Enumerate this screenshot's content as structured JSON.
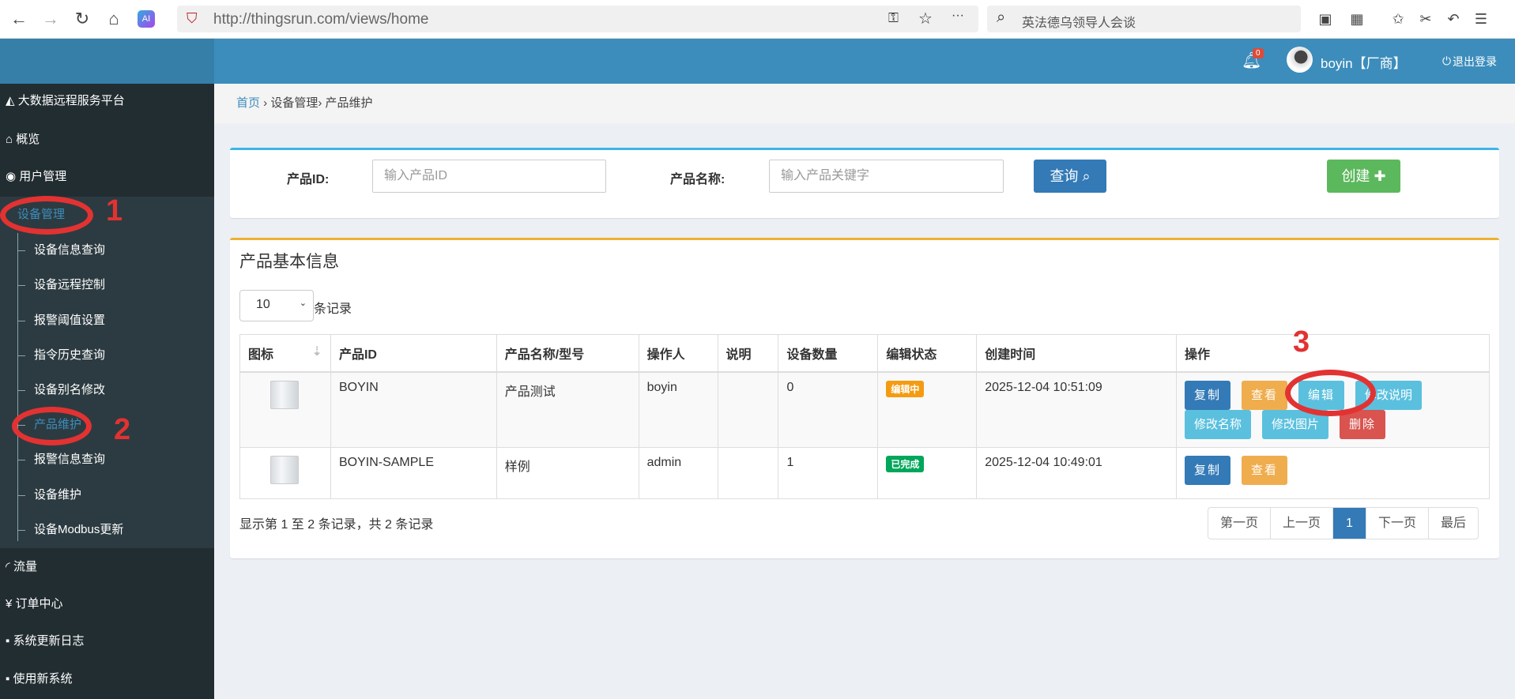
{
  "browser": {
    "url": "http://thingsrun.com/views/home",
    "search": "英法德乌领导人会谈",
    "ai_label": "AI"
  },
  "header": {
    "notif_count": "0",
    "user": "boyin【厂商】",
    "logout": "退出登录"
  },
  "sidebar": {
    "brand": "大数据远程服务平台",
    "items": [
      {
        "label": "概览"
      },
      {
        "label": "用户管理"
      },
      {
        "label": "设备管理"
      }
    ],
    "sub": [
      {
        "label": "设备信息查询"
      },
      {
        "label": "设备远程控制"
      },
      {
        "label": "报警阈值设置"
      },
      {
        "label": "指令历史查询"
      },
      {
        "label": "设备别名修改"
      },
      {
        "label": "产品维护"
      },
      {
        "label": "报警信息查询"
      },
      {
        "label": "设备维护"
      },
      {
        "label": "设备Modbus更新"
      }
    ],
    "bottom": [
      {
        "label": "流量"
      },
      {
        "label": "订单中心"
      },
      {
        "label": "系统更新日志"
      },
      {
        "label": "使用新系统"
      }
    ]
  },
  "breadcrumb": [
    "首页",
    "设备管理",
    "产品维护"
  ],
  "search": {
    "id_label": "产品ID:",
    "id_placeholder": "输入产品ID",
    "name_label": "产品名称:",
    "name_placeholder": "输入产品关键字",
    "query": "查询",
    "create": "创建"
  },
  "table": {
    "title": "产品基本信息",
    "page_size": "10",
    "page_size_suffix": "条记录",
    "columns": [
      "图标",
      "产品ID",
      "产品名称/型号",
      "操作人",
      "说明",
      "设备数量",
      "编辑状态",
      "创建时间",
      "操作"
    ],
    "rows": [
      {
        "id": "BOYIN",
        "name": "产品测试",
        "operator": "boyin",
        "desc": "",
        "count": "0",
        "status": "编辑中",
        "created": "2025-12-04 10:51:09",
        "actions": [
          "复制",
          "查看",
          "编辑",
          "修改说明",
          "修改名称",
          "修改图片",
          "删除"
        ]
      },
      {
        "id": "BOYIN-SAMPLE",
        "name": "样例",
        "operator": "admin",
        "desc": "",
        "count": "1",
        "status": "已完成",
        "created": "2025-12-04 10:49:01",
        "actions": [
          "复制",
          "查看"
        ]
      }
    ],
    "info": "显示第 1 至 2 条记录，共 2 条记录",
    "pager": [
      "第一页",
      "上一页",
      "1",
      "下一页",
      "最后"
    ]
  },
  "annotations": [
    "1",
    "2",
    "3"
  ],
  "colors": {
    "primary": "#337ab7",
    "warning": "#f0ad4e",
    "info": "#5bc0de",
    "danger": "#d9534f",
    "success": "#5cb85c",
    "header": "#3c8dbc",
    "sidebar": "#222d32"
  }
}
